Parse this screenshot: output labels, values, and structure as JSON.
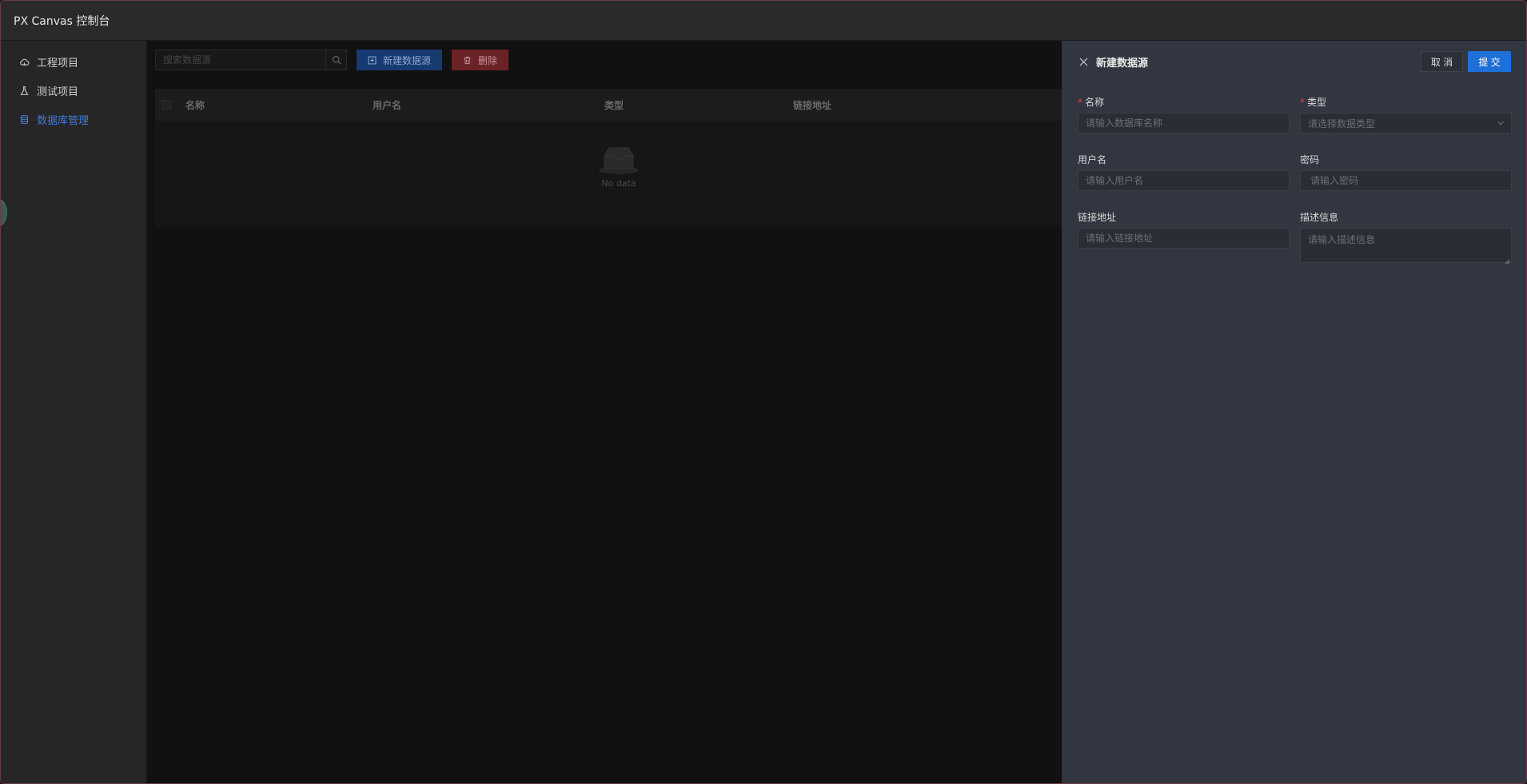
{
  "window": {
    "title": "PX Canvas 控制台"
  },
  "sidebar": {
    "items": [
      {
        "label": "工程项目",
        "icon": "cloud-icon",
        "active": false
      },
      {
        "label": "测试项目",
        "icon": "flask-icon",
        "active": false
      },
      {
        "label": "数据库管理",
        "icon": "database-icon",
        "active": true
      }
    ]
  },
  "toolbar": {
    "search_placeholder": "搜索数据源",
    "new_label": "新建数据源",
    "delete_label": "删除"
  },
  "table": {
    "columns": [
      "名称",
      "用户名",
      "类型",
      "链接地址"
    ],
    "empty_text": "No data"
  },
  "drawer": {
    "title": "新建数据源",
    "cancel_label": "取 消",
    "submit_label": "提 交",
    "fields": {
      "name": {
        "label": "名称",
        "required": true,
        "placeholder": "请输入数据库名称"
      },
      "type": {
        "label": "类型",
        "required": true,
        "placeholder": "请选择数据类型"
      },
      "username": {
        "label": "用户名",
        "placeholder": "请输入用户名"
      },
      "password": {
        "label": "密码",
        "placeholder": "请输入密码"
      },
      "url": {
        "label": "链接地址",
        "placeholder": "请输入链接地址"
      },
      "description": {
        "label": "描述信息",
        "placeholder": "请输入描述信息"
      }
    }
  },
  "colors": {
    "accent": "#1f6fd8",
    "active_nav": "#3f7ad6",
    "danger": "#6a2226",
    "required": "#e0443c"
  }
}
